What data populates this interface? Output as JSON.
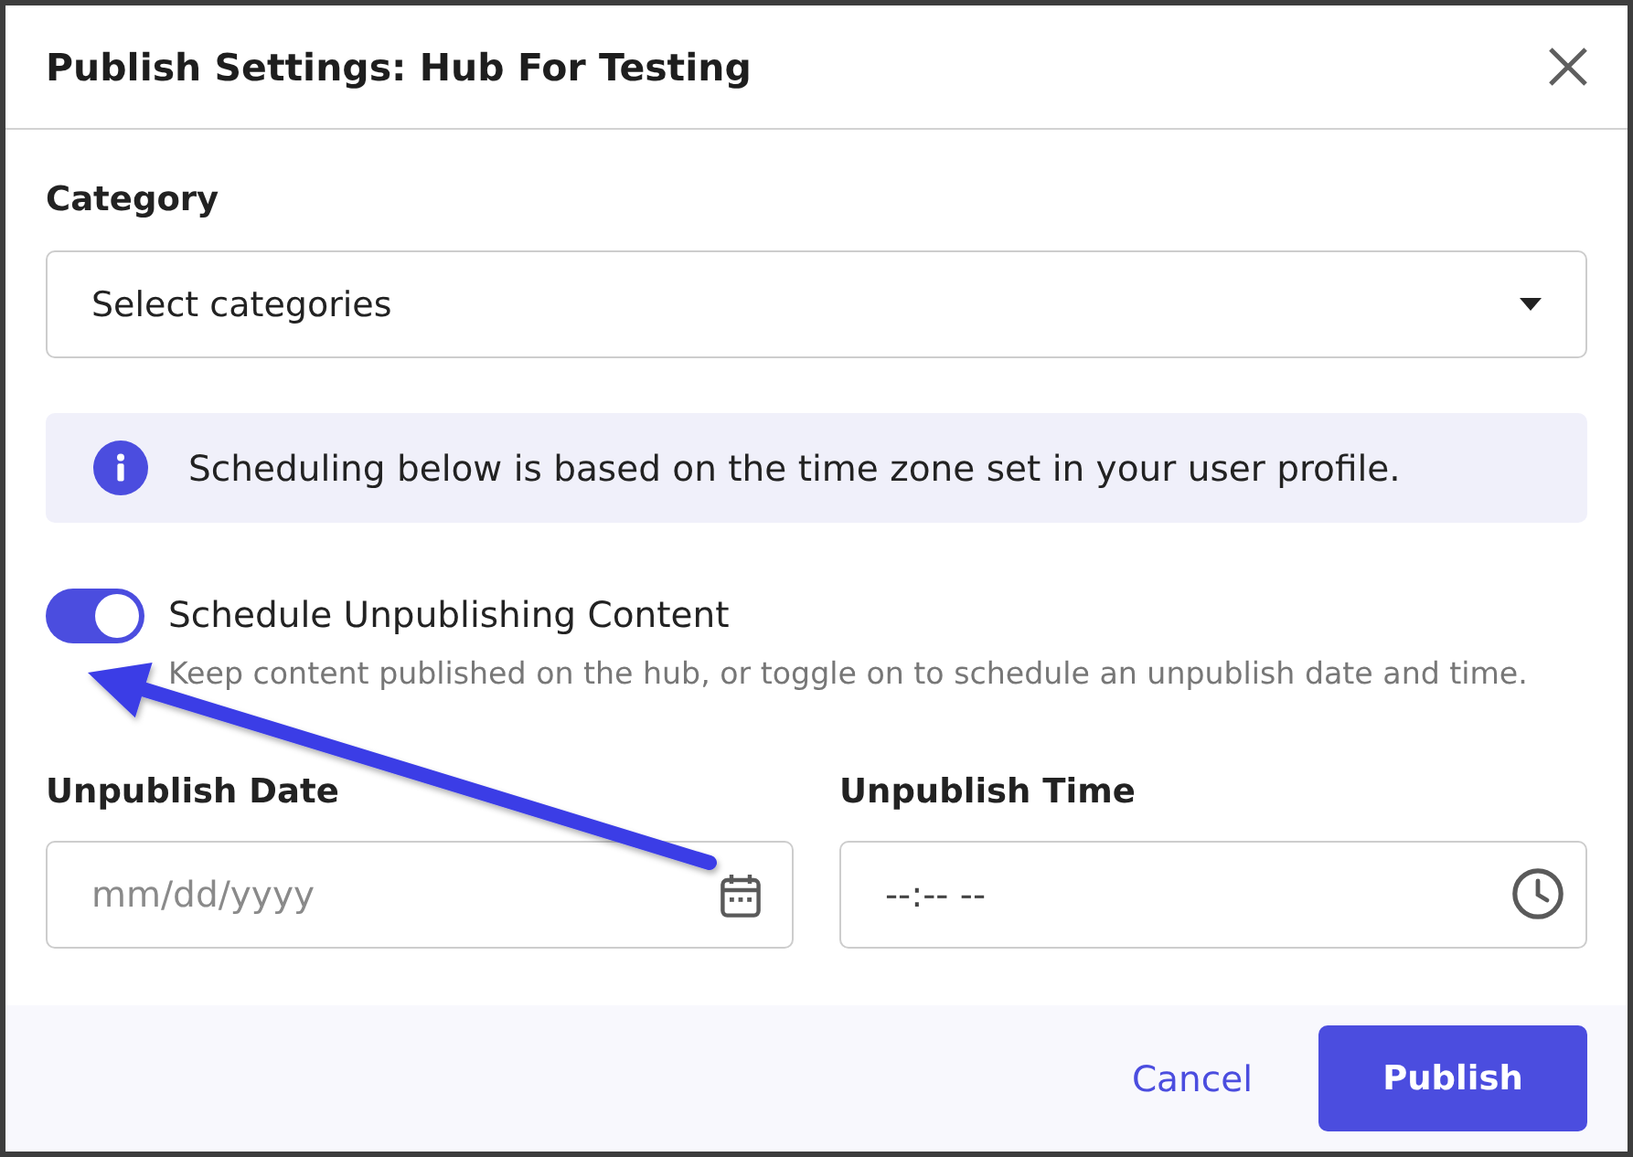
{
  "dialog": {
    "title": "Publish Settings: Hub For Testing"
  },
  "category": {
    "label": "Category",
    "placeholder": "Select categories"
  },
  "info_banner": {
    "text": "Scheduling below is based on the time zone set in your user profile."
  },
  "schedule_toggle": {
    "label": "Schedule Unpublishing Content",
    "description": "Keep content published on the hub, or toggle on to schedule an unpublish date and time.",
    "on": true
  },
  "fields": [
    {
      "kind": "date",
      "label": "Unpublish Date",
      "placeholder": "mm/dd/yyyy"
    },
    {
      "kind": "time",
      "label": "Unpublish Time",
      "placeholder": "--:-- --"
    }
  ],
  "buttons": [
    {
      "kind": "link",
      "label": "Cancel"
    },
    {
      "kind": "primary",
      "label": "Publish"
    }
  ]
}
